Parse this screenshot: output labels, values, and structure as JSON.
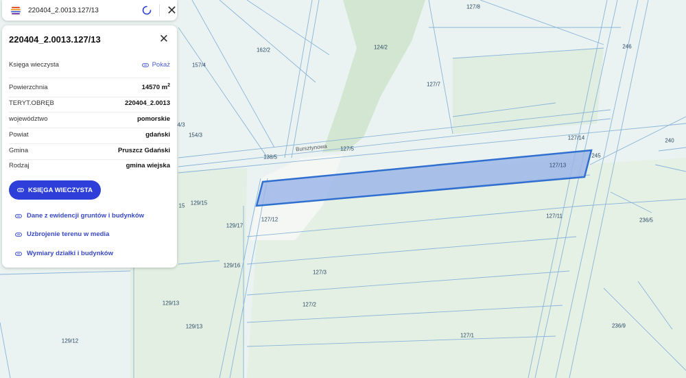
{
  "search": {
    "value": "220404_2.0013.127/13",
    "placeholder": ""
  },
  "panel": {
    "title": "220404_2.0013.127/13",
    "ksiega_label": "Księga wieczysta",
    "ksiega_link": "Pokaż",
    "rows": [
      {
        "label": "Powierzchnia",
        "value": "14570 m",
        "sup": "2"
      },
      {
        "label": "TERYT.OBRĘB",
        "value": "220404_2.0013"
      },
      {
        "label": "województwo",
        "value": "pomorskie"
      },
      {
        "label": "Powiat",
        "value": "gdański"
      },
      {
        "label": "Gmina",
        "value": "Pruszcz Gdański"
      },
      {
        "label": "Rodzaj",
        "value": "gmina wiejska"
      }
    ],
    "primary_button": "KSIĘGA WIECZYSTA",
    "links": [
      "Dane z ewidencji gruntów i budynków",
      "Uzbrojenie terenu w media",
      "Wymiary działki i budynków"
    ]
  },
  "map": {
    "street": "Bursztynowa",
    "selected_parcel": "127/13",
    "parcel_labels": [
      "127/8",
      "246",
      "162/2",
      "124/2",
      "157/4",
      "127/7",
      "4/3",
      "154/3",
      "127/14",
      "240",
      "127/5",
      "138/5",
      "245",
      "127/13",
      "15",
      "129/15",
      "127/12",
      "127/11",
      "236/5",
      "129/17",
      "129/16",
      "127/3",
      "129/13",
      "127/2",
      "129/13",
      "236/9",
      "127/1",
      "129/12"
    ]
  },
  "colors": {
    "accent": "#2d3fd8",
    "parcel_fill": "#9db6e8",
    "parcel_stroke": "#2f6fcf",
    "map_green": "#e2efe3",
    "map_light": "#eaf4f2"
  }
}
